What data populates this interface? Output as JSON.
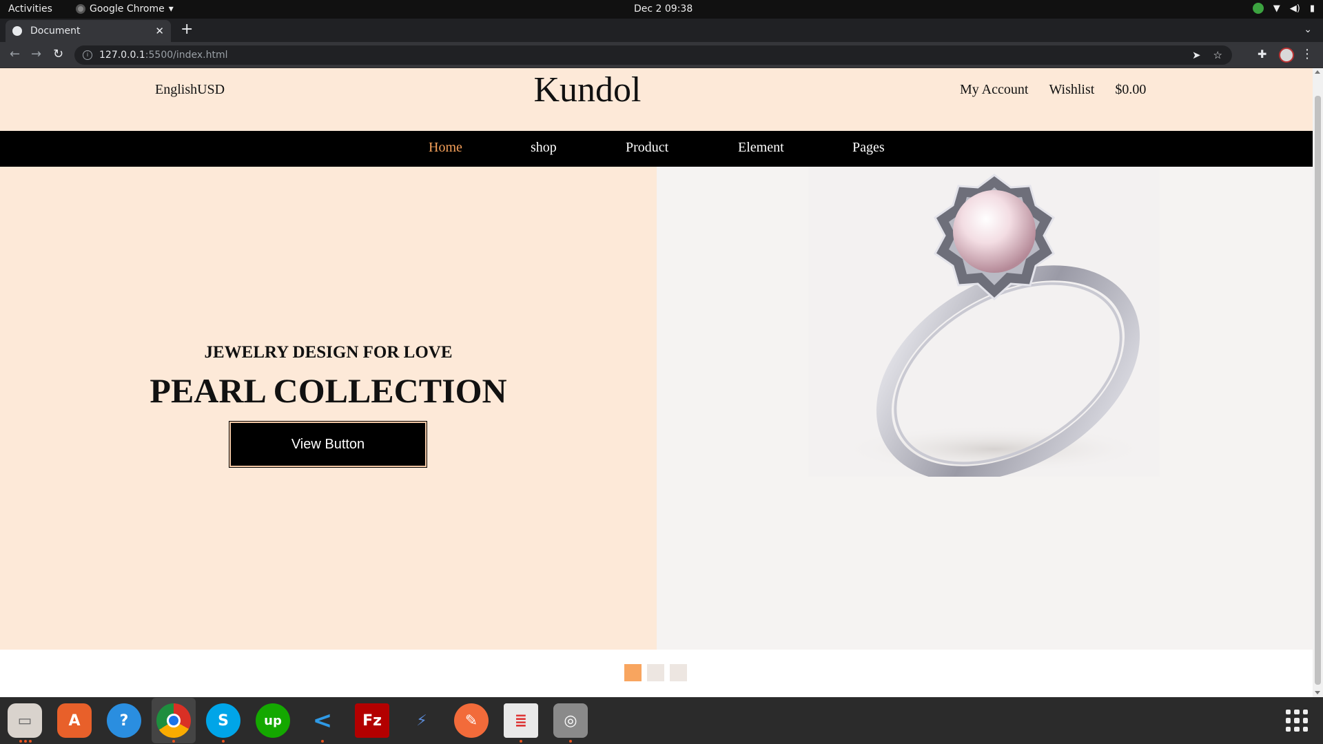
{
  "system_bar": {
    "activities": "Activities",
    "app_name": "Google Chrome",
    "datetime": "Dec 2  09:38"
  },
  "browser": {
    "tab_title": "Document",
    "url_host": "127.0.0.1",
    "url_path": ":5500/index.html"
  },
  "site": {
    "lang_currency": "EnglishUSD",
    "brand": "Kundol",
    "header_links": [
      "My Account",
      "Wishlist",
      "$0.00"
    ],
    "nav": [
      "Home",
      "shop",
      "Product",
      "Element",
      "Pages"
    ],
    "active_nav": "Home"
  },
  "hero": {
    "subtitle": "JEWELRY DESIGN FOR LOVE",
    "title": "PEARL COLLECTION",
    "button": "View Button",
    "image_subject": "pearl-diamond-ring"
  },
  "slider": {
    "count": 3,
    "active_index": 0
  },
  "dock": {
    "apps": [
      "Files",
      "Ubuntu Software",
      "Help",
      "Google Chrome",
      "Skype",
      "Upwork",
      "Visual Studio Code",
      "FileZilla",
      "Remote Desktop",
      "Postman",
      "Document Viewer",
      "Disks"
    ],
    "active_app": "Google Chrome"
  },
  "colors": {
    "header_bg": "#fde9d8",
    "nav_bg": "#000000",
    "accent": "#f5a05a",
    "hero_right_bg": "#f5f3f2"
  }
}
